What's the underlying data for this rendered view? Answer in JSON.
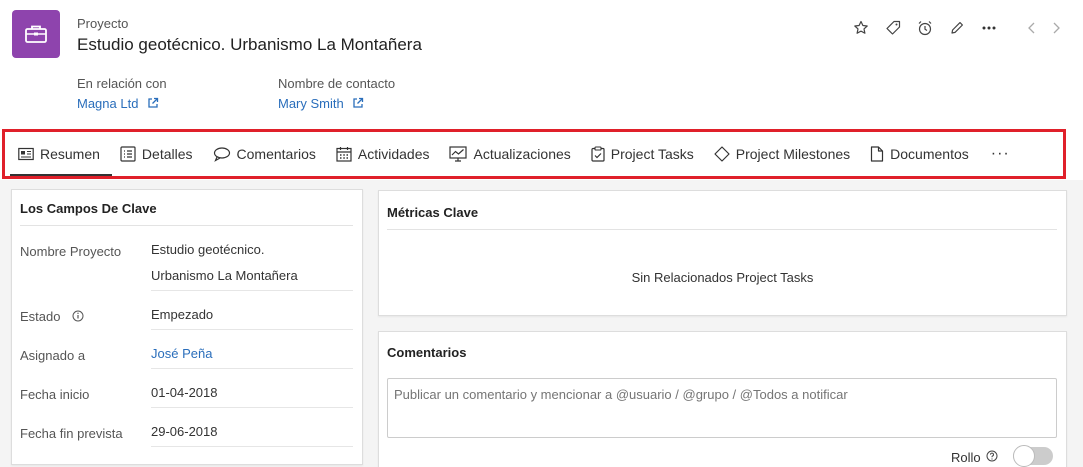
{
  "record": {
    "module_label": "Proyecto",
    "title": "Estudio geotécnico. Urbanismo La Montañera",
    "module_icon": "briefcase-icon",
    "module_color": "#8e44ad"
  },
  "relations": [
    {
      "label": "En relación con",
      "value": "Magna Ltd"
    },
    {
      "label": "Nombre de contacto",
      "value": "Mary Smith"
    }
  ],
  "actions": [
    "star-icon",
    "tag-icon",
    "alarm-icon",
    "edit-icon",
    "more-icon"
  ],
  "tabs": [
    {
      "label": "Resumen",
      "icon": "summary-card-icon",
      "active": true
    },
    {
      "label": "Detalles",
      "icon": "details-list-icon"
    },
    {
      "label": "Comentarios",
      "icon": "comments-icon"
    },
    {
      "label": "Actividades",
      "icon": "calendar-icon"
    },
    {
      "label": "Actualizaciones",
      "icon": "updates-chart-icon"
    },
    {
      "label": "Project Tasks",
      "icon": "clipboard-check-icon"
    },
    {
      "label": "Project Milestones",
      "icon": "diamond-icon"
    },
    {
      "label": "Documentos",
      "icon": "document-icon"
    },
    {
      "label": "···",
      "icon": "more-icon"
    }
  ],
  "key_fields": {
    "title": "Los Campos De Clave",
    "fields": [
      {
        "label": "Nombre Proyecto",
        "value_line1": "Estudio geotécnico.",
        "value_line2": "Urbanismo La Montañera"
      },
      {
        "label": "Estado",
        "value": "Empezado"
      },
      {
        "label": "Asignado a",
        "value": "José Peña"
      },
      {
        "label": "Fecha inicio",
        "value": "01-04-2018"
      },
      {
        "label": "Fecha fin prevista",
        "value": "29-06-2018"
      }
    ]
  },
  "metrics": {
    "title": "Métricas Clave",
    "empty_message": "Sin Relacionados Project Tasks"
  },
  "comments": {
    "title": "Comentarios",
    "placeholder": "Publicar un comentario y mencionar a @usuario / @grupo / @Todos a notificar",
    "rollo_label": "Rollo",
    "rollo_enabled": false
  },
  "colors": {
    "accent_link": "#2a6ebb",
    "highlight_border": "#e0202a"
  }
}
